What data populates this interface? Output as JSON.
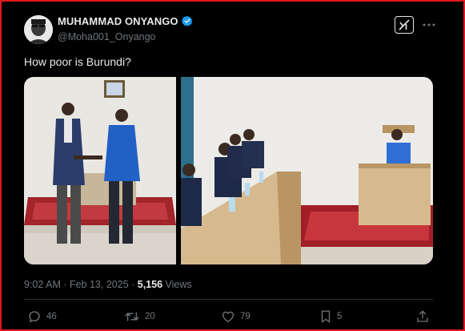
{
  "author": {
    "display_name": "MUHAMMAD ONYANGO",
    "handle": "@Moha001_Onyango",
    "verified": true,
    "avatar_icon": "avatar-icon"
  },
  "tweet": {
    "text": "How poor is Burundi?",
    "timestamp": "9:02 AM · Feb 13, 2025 · ",
    "views_count": "5,156",
    "views_label": " Views"
  },
  "media": [
    {
      "description_icon": "photo-two-men-handshake"
    },
    {
      "description_icon": "photo-meeting-room"
    }
  ],
  "actions": {
    "reply_count": "46",
    "retweet_count": "20",
    "like_count": "79",
    "bookmark_count": "5"
  },
  "colors": {
    "background": "#000000",
    "text_primary": "#e7e9ea",
    "text_secondary": "#71767b",
    "verified_badge": "#1d9bf0",
    "frame_border": "#e0171f",
    "divider": "#2f3336"
  }
}
